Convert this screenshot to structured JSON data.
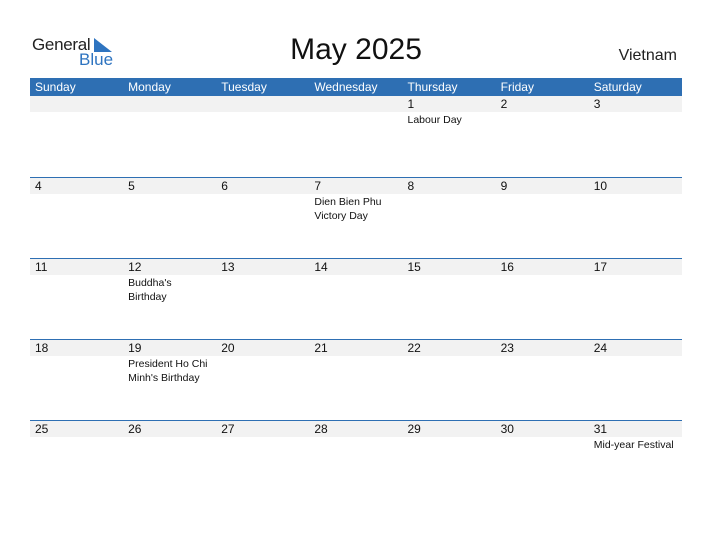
{
  "logo": {
    "line1": "General",
    "line2": "Blue",
    "accent_color": "#2e74c0"
  },
  "title": "May 2025",
  "country": "Vietnam",
  "header_color": "#2e6fb3",
  "weekdays": [
    "Sunday",
    "Monday",
    "Tuesday",
    "Wednesday",
    "Thursday",
    "Friday",
    "Saturday"
  ],
  "weeks": [
    {
      "days": [
        "",
        "",
        "",
        "",
        "1",
        "2",
        "3"
      ],
      "events": [
        "",
        "",
        "",
        "",
        "Labour Day",
        "",
        ""
      ]
    },
    {
      "days": [
        "4",
        "5",
        "6",
        "7",
        "8",
        "9",
        "10"
      ],
      "events": [
        "",
        "",
        "",
        "Dien Bien Phu Victory Day",
        "",
        "",
        ""
      ]
    },
    {
      "days": [
        "11",
        "12",
        "13",
        "14",
        "15",
        "16",
        "17"
      ],
      "events": [
        "",
        "Buddha's Birthday",
        "",
        "",
        "",
        "",
        ""
      ]
    },
    {
      "days": [
        "18",
        "19",
        "20",
        "21",
        "22",
        "23",
        "24"
      ],
      "events": [
        "",
        "President Ho Chi Minh's Birthday",
        "",
        "",
        "",
        "",
        ""
      ]
    },
    {
      "days": [
        "25",
        "26",
        "27",
        "28",
        "29",
        "30",
        "31"
      ],
      "events": [
        "",
        "",
        "",
        "",
        "",
        "",
        "Mid-year Festival"
      ]
    }
  ]
}
